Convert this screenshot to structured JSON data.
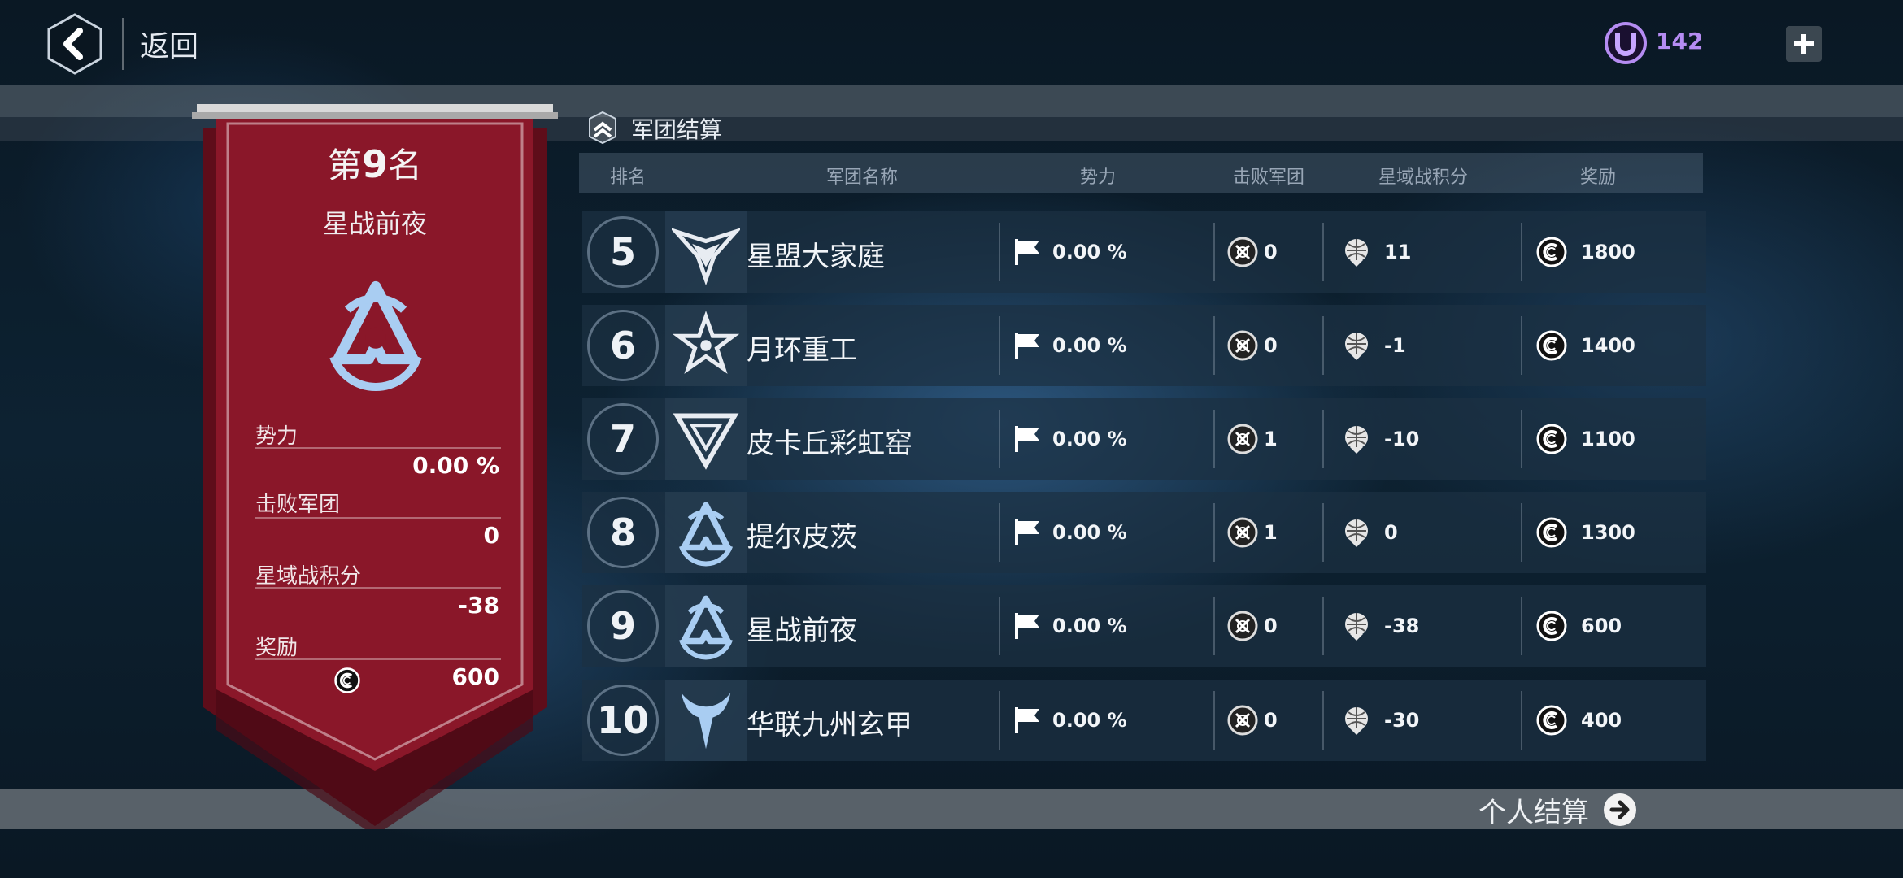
{
  "header": {
    "back_label": "返回",
    "currency_value": "142",
    "currency_icon": "u-coin-icon"
  },
  "banner": {
    "rank_prefix": "第",
    "rank_number": "9",
    "rank_suffix": "名",
    "team_name": "星战前夜",
    "emblem": "triangle-emblem-icon",
    "stats": {
      "power_label": "势力",
      "power_value": "0.00 %",
      "defeated_label": "击败军团",
      "defeated_value": "0",
      "score_label": "星域战积分",
      "score_value": "-38",
      "reward_label": "奖励",
      "reward_value": "600"
    }
  },
  "section_title": "军团结算",
  "table": {
    "headers": [
      "排名",
      "军团名称",
      "势力",
      "击败军团",
      "星域战积分",
      "奖励"
    ],
    "rows": [
      {
        "rank": "5",
        "emblem": "winged-star-emblem-icon",
        "name": "星盟大家庭",
        "power": "0.00 %",
        "defeated": "0",
        "score": "11",
        "reward": "1800"
      },
      {
        "rank": "6",
        "emblem": "star-crest-emblem-icon",
        "name": "月环重工",
        "power": "0.00 %",
        "defeated": "0",
        "score": "-1",
        "reward": "1400"
      },
      {
        "rank": "7",
        "emblem": "inverted-triangle-emblem-icon",
        "name": "皮卡丘彩虹窑",
        "power": "0.00 %",
        "defeated": "1",
        "score": "-10",
        "reward": "1100"
      },
      {
        "rank": "8",
        "emblem": "triangle-emblem-icon",
        "name": "提尔皮茨",
        "power": "0.00 %",
        "defeated": "1",
        "score": "0",
        "reward": "1300"
      },
      {
        "rank": "9",
        "emblem": "triangle-emblem-icon",
        "name": "星战前夜",
        "power": "0.00 %",
        "defeated": "0",
        "score": "-38",
        "reward": "600"
      },
      {
        "rank": "10",
        "emblem": "horned-emblem-icon",
        "name": "华联九州玄甲",
        "power": "0.00 %",
        "defeated": "0",
        "score": "-30",
        "reward": "400"
      }
    ]
  },
  "footer": {
    "personal_label": "个人结算"
  },
  "colors": {
    "banner": "#7e1526",
    "accent_purple": "#b58cf2",
    "emblem_blue": "#a9cdf2"
  }
}
